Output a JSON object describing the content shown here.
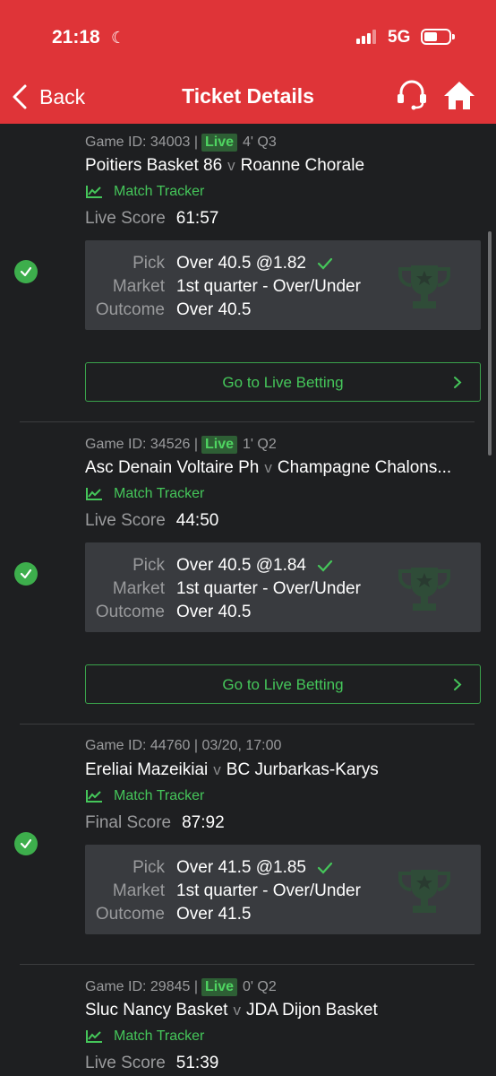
{
  "status": {
    "time": "21:18",
    "network": "5G"
  },
  "header": {
    "back_label": "Back",
    "title": "Ticket Details"
  },
  "labels": {
    "match_tracker": "Match Tracker",
    "pick": "Pick",
    "market": "Market",
    "outcome": "Outcome",
    "go_live": "Go to Live Betting"
  },
  "games": [
    {
      "game_id": "Game ID: 34003 |",
      "live_badge": "Live",
      "timing": "4' Q3",
      "home": "Poitiers Basket 86",
      "vs": "v",
      "away": "Roanne Chorale",
      "score_label": "Live Score",
      "score": "61:57",
      "pick": "Over 40.5 @1.82",
      "market": "1st quarter - Over/Under",
      "outcome": "Over 40.5"
    },
    {
      "game_id": "Game ID: 34526 |",
      "live_badge": "Live",
      "timing": "1' Q2",
      "home": "Asc Denain Voltaire Ph",
      "vs": "v",
      "away": "Champagne Chalons...",
      "score_label": "Live Score",
      "score": "44:50",
      "pick": "Over 40.5 @1.84",
      "market": "1st quarter - Over/Under",
      "outcome": "Over 40.5"
    },
    {
      "game_id": "Game ID: 44760 | 03/20, 17:00",
      "home": "Ereliai Mazeikiai",
      "vs": "v",
      "away": "BC Jurbarkas-Karys",
      "score_label": "Final Score",
      "score": "87:92",
      "pick": "Over 41.5 @1.85",
      "market": "1st quarter - Over/Under",
      "outcome": "Over 41.5"
    },
    {
      "game_id": "Game ID: 29845 |",
      "live_badge": "Live",
      "timing": "0' Q2",
      "home": "Sluc Nancy Basket",
      "vs": "v",
      "away": "JDA Dijon Basket",
      "score_label": "Live Score",
      "score": "51:39"
    }
  ],
  "colors": {
    "header": "#df3438",
    "background": "#1e1f21",
    "accent_green": "#45c65a",
    "panel": "#393b3f"
  }
}
